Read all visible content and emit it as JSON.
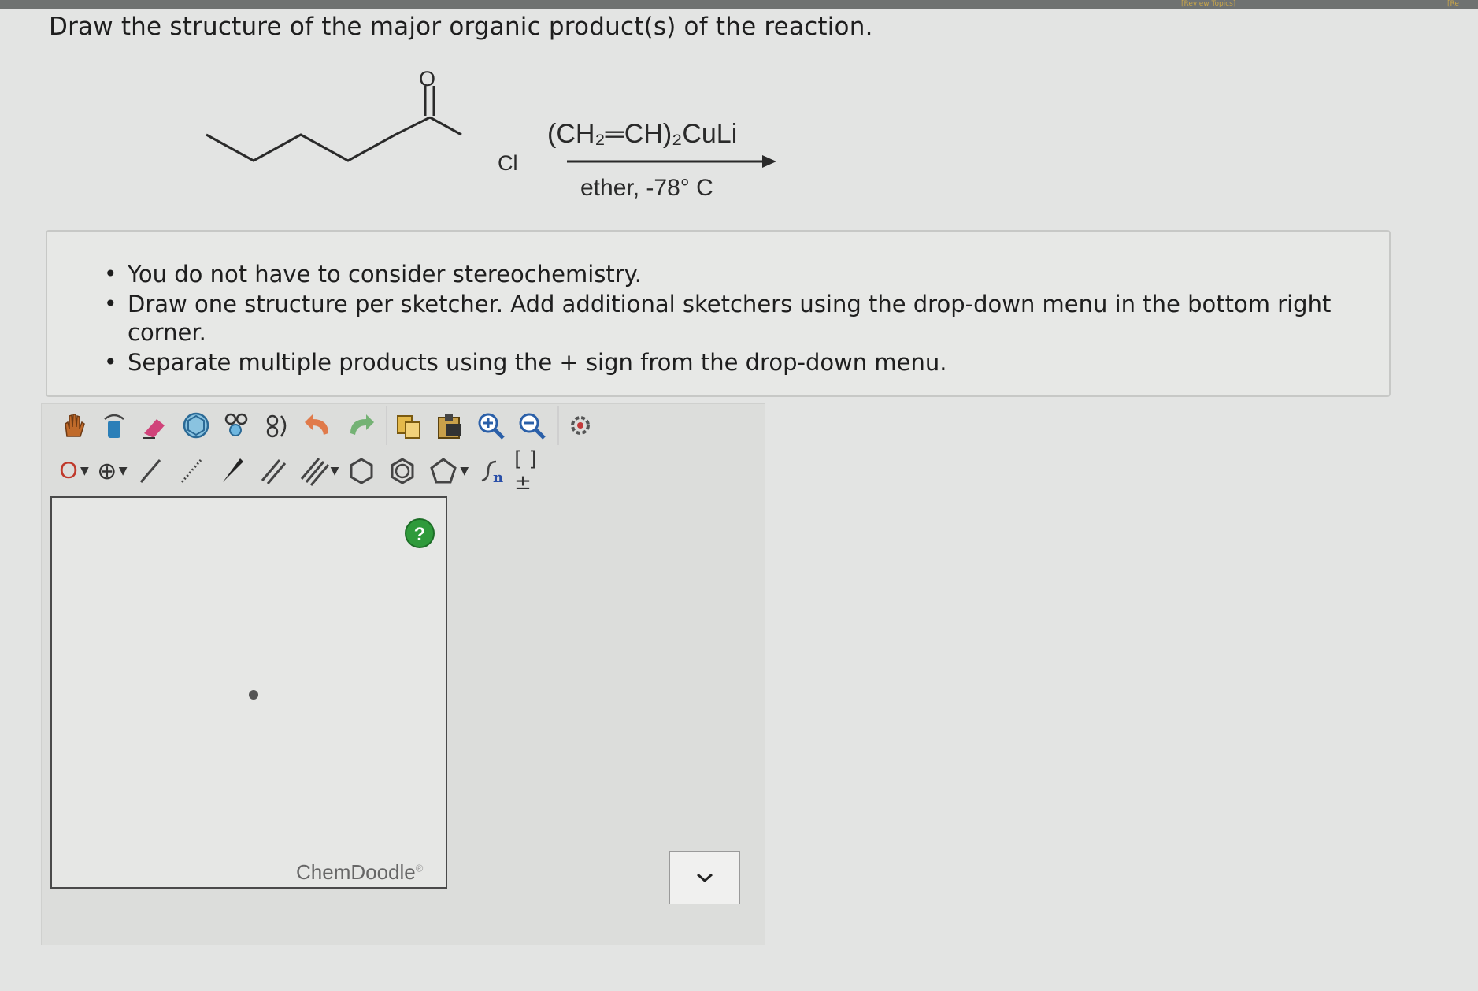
{
  "header": {
    "link_left": "[Review Topics]",
    "link_right": "[Re"
  },
  "question": {
    "prompt": "Draw the structure of the major organic product(s) of the reaction."
  },
  "reaction": {
    "oxygen_label": "O",
    "chlorine_label": "Cl",
    "reagent_above": "(CH₂═CH)₂CuLi",
    "reagent_below": "ether, -78° C"
  },
  "instructions": {
    "items": [
      "You do not have to consider stereochemistry.",
      "Draw one structure per sketcher. Add additional sketchers using the drop-down menu in the bottom right corner.",
      "Separate multiple products using the + sign from the drop-down menu."
    ]
  },
  "toolbar": {
    "row1": [
      "hand-icon",
      "lasso-icon",
      "eraser-icon",
      "ring-template-icon",
      "clean-icon",
      "three-d-icon",
      "undo-icon",
      "redo-icon",
      "copy-icon",
      "paste-icon",
      "zoom-in-icon",
      "zoom-out-icon",
      "settings-icon"
    ],
    "atom_label": "O",
    "plus_label": "⊕",
    "sgroup_label": "n",
    "bracket_label": "[ ]±"
  },
  "sketcher": {
    "help_label": "?",
    "brand": "ChemDoodle",
    "brand_mark": "®"
  },
  "colors": {
    "help_green": "#2f9a3b",
    "undo_orange": "#e07a4a",
    "redo_green": "#5aa85a",
    "zoom_blue": "#2a5fa8"
  }
}
